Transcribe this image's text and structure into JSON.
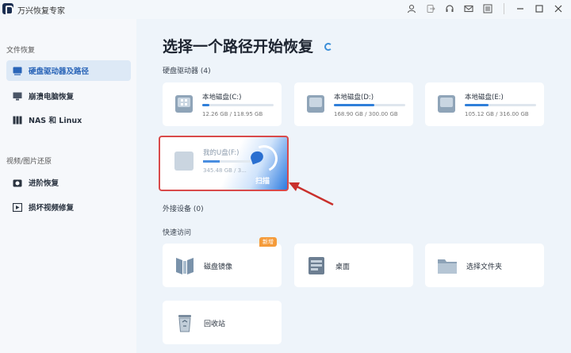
{
  "app": {
    "title": "万兴恢复专家",
    "window_icons": [
      "user-icon",
      "exit-icon",
      "headset-icon",
      "mail-icon",
      "menu-icon",
      "minimize-icon",
      "maximize-icon",
      "close-icon"
    ]
  },
  "sidebar": {
    "section1_label": "文件恢复",
    "items": [
      {
        "label": "硬盘驱动器及路径",
        "icon": "drive-icon",
        "active": true
      },
      {
        "label": "崩溃电脑恢复",
        "icon": "monitor-icon",
        "active": false
      },
      {
        "label": "NAS 和 Linux",
        "icon": "nas-icon",
        "active": false
      }
    ],
    "section2_label": "视频/图片还原",
    "items2": [
      {
        "label": "进阶恢复",
        "icon": "camera-icon",
        "active": false
      },
      {
        "label": "损坏视频修复",
        "icon": "video-repair-icon",
        "active": false
      }
    ]
  },
  "main": {
    "title": "选择一个路径开始恢复",
    "drives_label": "硬盘驱动器 (4)",
    "drives": [
      {
        "name": "本地磁盘(C:)",
        "size": "12.26 GB / 118.95 GB",
        "used_percent": 10.3,
        "windows": true
      },
      {
        "name": "本地磁盘(D:)",
        "size": "168.90 GB / 300.00 GB",
        "used_percent": 56.3,
        "windows": false
      },
      {
        "name": "本地磁盘(E:)",
        "size": "105.12 GB / 316.00 GB",
        "used_percent": 33.3,
        "windows": false
      }
    ],
    "usb": {
      "name": "我的U盘(F:)",
      "size": "345.48 GB / 3...",
      "used_percent": 35,
      "scan_label": "扫描"
    },
    "external_label": "外接设备 (0)",
    "quick_label": "快速访问",
    "quick": [
      {
        "name": "磁盘镜像",
        "icon": "disk-image-icon",
        "badge": "新增"
      },
      {
        "name": "桌面",
        "icon": "desktop-icon",
        "badge": ""
      },
      {
        "name": "选择文件夹",
        "icon": "folder-icon",
        "badge": ""
      },
      {
        "name": "回收站",
        "icon": "recycle-bin-icon",
        "badge": ""
      }
    ],
    "colors": {
      "accent": "#2f7fd9",
      "highlight_border": "#d94a4a",
      "badge": "#f59b3a"
    }
  }
}
